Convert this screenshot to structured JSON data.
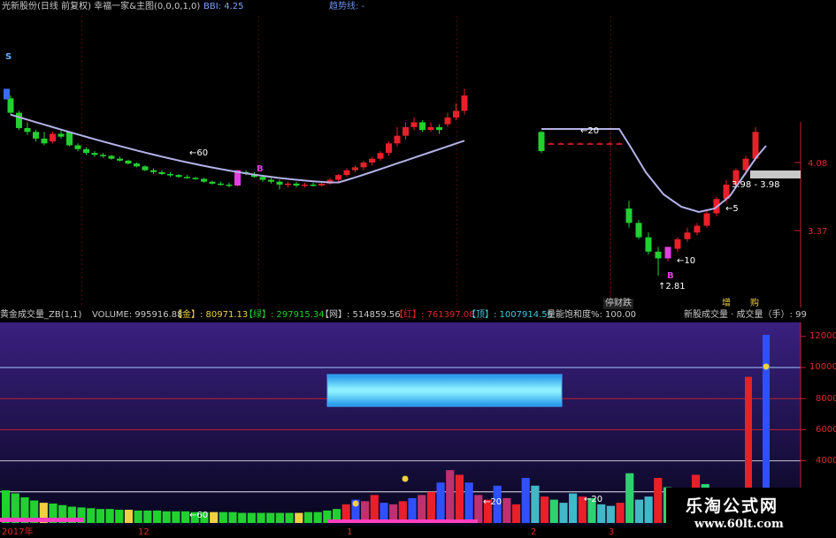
{
  "header": {
    "title": "光新股份(日线 前复权) 幸福一家&主图(0,0,0,1,0)",
    "bbi_label": "BBI: 4.25",
    "trend_label": "趋势线: -"
  },
  "colors": {
    "up": "#e8202a",
    "down": "#22d030",
    "bbi": "#b4b2e8",
    "accent": "#e040e0",
    "volume_bg_top": "#301a70",
    "volume_bg_bottom": "#0a0830",
    "grid": "#c02030",
    "cyan": "#40b8c8",
    "gold": "#f0d040"
  },
  "price_axis": {
    "labels": [
      "4.08",
      "3.37"
    ]
  },
  "volume_header": {
    "name": "黄金成交量_ZB(1,1)",
    "volume": "VOLUME: 995916.88",
    "gold": "【金】: 80971.13",
    "green": "【绿】: 297915.34",
    "net": "【网】: 514859.56",
    "red": "【红】: 761397.08",
    "top": "【顶】: 1007914.56",
    "ratio": "量能饱和度%: 100.00",
    "right": "新股成交量 · 成交量（手）: 99"
  },
  "volume_axis": {
    "labels": [
      "12000",
      "10000",
      "8000",
      "6000",
      "4000"
    ]
  },
  "date_labels": [
    "2017年",
    "12",
    "1",
    "2",
    "3"
  ],
  "annotations": {
    "s_marker": "S",
    "b_marker": "B",
    "b2_marker": "B",
    "ann_60": "60",
    "ann_20": "20",
    "ann_10": "10",
    "ann_5": "5",
    "ann_281": "2.81",
    "ann_398": "3.98",
    "ann_398b": "3.98",
    "vol_60": "60",
    "vol_20a": "20",
    "vol_20b": "20",
    "label_zhang": "增",
    "label_mai": "购",
    "label_gap": "停财跌"
  },
  "watermark": {
    "line1": "乐淘公式网",
    "line2": "www.60lt.com"
  },
  "chart_data": [
    {
      "type": "candlestick",
      "name": "",
      "price_labels": [
        4.08,
        3.37
      ],
      "series": [
        {
          "segment": 1,
          "candles": [
            [
              4.75,
              4.6,
              4.78,
              4.58
            ],
            [
              4.6,
              4.44,
              4.62,
              4.42
            ],
            [
              4.44,
              4.4,
              4.5,
              4.37
            ],
            [
              4.4,
              4.33,
              4.42,
              4.3
            ],
            [
              4.33,
              4.28,
              4.4,
              4.26
            ],
            [
              4.3,
              4.38,
              4.4,
              4.28
            ],
            [
              4.38,
              4.35,
              4.42,
              4.33
            ],
            [
              4.4,
              4.26,
              4.41,
              4.25
            ],
            [
              4.26,
              4.22,
              4.28,
              4.2
            ],
            [
              4.22,
              4.18,
              4.24,
              4.16
            ],
            [
              4.18,
              4.16,
              4.2,
              4.14
            ],
            [
              4.16,
              4.15,
              4.18,
              4.13
            ],
            [
              4.15,
              4.12,
              4.16,
              4.11
            ],
            [
              4.12,
              4.1,
              4.14,
              4.09
            ],
            [
              4.1,
              4.07,
              4.11,
              4.06
            ],
            [
              4.07,
              4.04,
              4.08,
              4.03
            ],
            [
              4.04,
              4.0,
              4.05,
              3.99
            ],
            [
              4.0,
              3.98,
              4.02,
              3.96
            ],
            [
              3.98,
              3.96,
              4.0,
              3.95
            ],
            [
              3.96,
              3.95,
              3.98,
              3.93
            ],
            [
              3.95,
              3.93,
              3.96,
              3.92
            ],
            [
              3.93,
              3.92,
              3.95,
              3.91
            ],
            [
              3.92,
              3.91,
              3.93,
              3.9
            ],
            [
              3.91,
              3.88,
              3.92,
              3.87
            ],
            [
              3.88,
              3.86,
              3.89,
              3.85
            ],
            [
              3.86,
              3.85,
              3.88,
              3.84
            ],
            [
              3.85,
              3.84,
              3.87,
              3.82
            ],
            [
              3.84,
              3.98,
              4.0,
              3.83
            ],
            [
              3.98,
              3.96,
              4.0,
              3.95
            ],
            [
              3.96,
              3.93,
              3.98,
              3.92
            ],
            [
              3.93,
              3.9,
              3.95,
              3.88
            ],
            [
              3.9,
              3.88,
              3.92,
              3.86
            ],
            [
              3.88,
              3.85,
              3.9,
              3.8
            ],
            [
              3.85,
              3.86,
              3.88,
              3.82
            ],
            [
              3.86,
              3.84,
              3.88,
              3.82
            ],
            [
              3.84,
              3.85,
              3.87,
              3.82
            ],
            [
              3.85,
              3.84,
              3.87,
              3.83
            ],
            [
              3.84,
              3.86,
              3.88,
              3.83
            ],
            [
              3.86,
              3.9,
              3.92,
              3.85
            ],
            [
              3.9,
              3.95,
              3.96,
              3.88
            ],
            [
              3.95,
              4.0,
              4.02,
              3.93
            ],
            [
              4.0,
              4.03,
              4.05,
              3.98
            ],
            [
              4.03,
              4.08,
              4.1,
              4.0
            ],
            [
              4.08,
              4.12,
              4.14,
              4.05
            ],
            [
              4.12,
              4.18,
              4.2,
              4.1
            ],
            [
              4.18,
              4.28,
              4.3,
              4.15
            ],
            [
              4.28,
              4.36,
              4.45,
              4.25
            ],
            [
              4.36,
              4.45,
              4.5,
              4.32
            ],
            [
              4.45,
              4.5,
              4.55,
              4.42
            ],
            [
              4.5,
              4.42,
              4.52,
              4.4
            ],
            [
              4.42,
              4.45,
              4.5,
              4.4
            ],
            [
              4.45,
              4.42,
              4.48,
              4.38
            ],
            [
              4.48,
              4.55,
              4.6,
              4.45
            ],
            [
              4.55,
              4.62,
              4.7,
              4.52
            ],
            [
              4.62,
              4.78,
              4.85,
              4.58
            ]
          ]
        },
        {
          "segment": 2,
          "candles": [
            [
              4.4,
              4.2,
              4.41,
              4.18
            ],
            [
              4.28,
              4.28,
              4.29,
              4.27
            ],
            [
              4.28,
              4.28,
              4.29,
              4.27
            ],
            [
              4.28,
              4.28,
              4.29,
              4.27
            ],
            [
              4.28,
              4.28,
              4.29,
              4.27
            ],
            [
              4.28,
              4.28,
              4.29,
              4.27
            ],
            [
              4.28,
              4.28,
              4.29,
              4.27
            ],
            [
              4.28,
              4.28,
              4.29,
              4.27
            ],
            [
              4.28,
              4.28,
              4.29,
              4.27
            ],
            [
              3.6,
              3.45,
              3.68,
              3.4
            ],
            [
              3.45,
              3.3,
              3.48,
              3.28
            ],
            [
              3.3,
              3.15,
              3.35,
              3.12
            ],
            [
              3.15,
              3.08,
              3.2,
              2.9
            ],
            [
              3.08,
              3.18,
              3.2,
              3.05
            ],
            [
              3.18,
              3.28,
              3.3,
              3.15
            ],
            [
              3.28,
              3.35,
              3.4,
              3.25
            ],
            [
              3.35,
              3.42,
              3.45,
              3.32
            ],
            [
              3.42,
              3.55,
              3.58,
              3.4
            ],
            [
              3.55,
              3.7,
              3.72,
              3.52
            ],
            [
              3.7,
              3.85,
              3.9,
              3.66
            ],
            [
              3.85,
              4.0,
              4.02,
              3.82
            ],
            [
              4.0,
              4.12,
              4.15,
              3.95
            ],
            [
              4.12,
              4.4,
              4.45,
              4.1
            ]
          ]
        }
      ]
    },
    {
      "type": "bar",
      "name": "",
      "ylim": [
        0,
        13000
      ],
      "y_ticks": [
        12000,
        10000,
        8000,
        6000,
        4000
      ],
      "hlines": [
        10000,
        8000,
        6000,
        4000
      ],
      "series": [
        {
          "segment": 1,
          "values": [
            2100,
            1900,
            1650,
            1450,
            1300,
            1250,
            1150,
            1050,
            1000,
            950,
            900,
            900,
            850,
            850,
            800,
            800,
            800,
            750,
            750,
            750,
            700,
            700,
            700,
            700,
            700,
            650,
            650,
            650,
            650,
            650,
            650,
            650,
            700,
            700,
            800,
            900,
            1200,
            1500,
            1400,
            1800,
            1300,
            1200,
            1400,
            1600,
            1800,
            2000,
            2600,
            3400,
            3100,
            2600,
            1800,
            1500,
            2400,
            1600,
            1200,
            2900,
            2400,
            1700,
            1500,
            1300,
            1900,
            1700,
            1600,
            1200,
            1100,
            1300,
            3200,
            1500,
            1700,
            2900,
            2300,
            1900,
            1600,
            3100,
            2500,
            2100
          ]
        },
        {
          "segment": 2,
          "values": [
            1600,
            9400,
            12100
          ]
        }
      ]
    }
  ]
}
